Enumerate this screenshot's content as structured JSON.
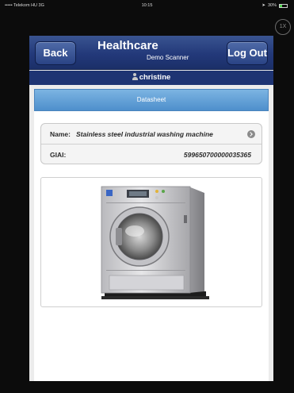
{
  "status_bar": {
    "carrier": "••••• Telekom HU  3G",
    "time": "10:15",
    "battery": "30%",
    "battery_fraction": 0.3
  },
  "zoom_label": "1X",
  "navbar": {
    "back_label": "Back",
    "title": "Healthcare",
    "subtitle": "Demo Scanner",
    "logout_label": "Log Out"
  },
  "user": {
    "name": "christine"
  },
  "datasheet": {
    "title": "Datasheet",
    "rows": [
      {
        "label": "Name:",
        "value": "Stainless steel industrial washing machine"
      },
      {
        "label": "GIAI:",
        "value": "599650700000035365"
      }
    ]
  },
  "colors": {
    "navbar": "#23397a",
    "header": "#5c9bd5",
    "background": "#ececec"
  }
}
